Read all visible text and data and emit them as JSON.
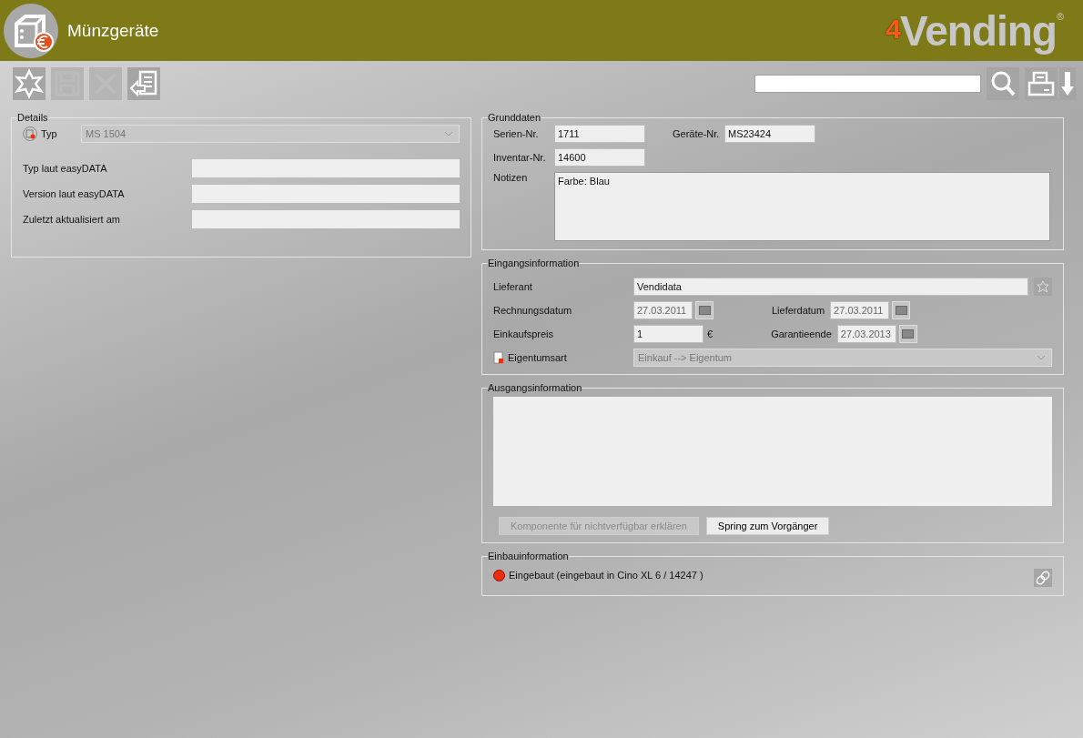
{
  "header": {
    "title": "Münzgeräte",
    "logo": {
      "prefix": "4",
      "text": "Vending",
      "mark": "®"
    }
  },
  "toolbar": [
    {
      "kind": "new",
      "disabled": false
    },
    {
      "kind": "save",
      "disabled": true
    },
    {
      "kind": "delete",
      "disabled": true
    },
    {
      "kind": "back",
      "disabled": false
    }
  ],
  "details": {
    "title": "Details",
    "type": {
      "label": "Typ",
      "value": "MS 1504",
      "disabled": true
    },
    "fields": [
      {
        "label": "Typ laut easyDATA"
      },
      {
        "label": "Version laut easyDATA"
      },
      {
        "label": "Zuletzt aktualisiert am"
      }
    ]
  },
  "grunddaten": {
    "title": "Grunddaten",
    "serial": {
      "label": "Serien-Nr.",
      "value": "1711"
    },
    "device": {
      "label": "Geräte-Nr.",
      "value": "MS23424"
    },
    "inventory": {
      "label": "Inventar-Nr.",
      "value": "14600"
    },
    "notes": {
      "label": "Notizen",
      "value": "Farbe: Blau"
    }
  },
  "eingang": {
    "title": "Eingangsinformation",
    "supplier": {
      "label": "Lieferant",
      "value": "Vendidata"
    },
    "invoice_date": {
      "label": "Rechnungsdatum",
      "value": "27.03.2011",
      "disabled": true
    },
    "delivery_date": {
      "label": "Lieferdatum",
      "value": "27.03.2011",
      "disabled": true
    },
    "price": {
      "label": "Einkaufspreis",
      "value": "1",
      "currency": "€"
    },
    "warranty_end": {
      "label": "Garantieende",
      "value": "27.03.2013",
      "disabled": true
    },
    "ownership": {
      "label": "Eigentumsart",
      "value": "Einkauf --> Eigentum",
      "disabled": true
    }
  },
  "ausgang": {
    "title": "Ausgangsinformation",
    "buttons": [
      {
        "label": "Komponente für nichtverfügbar erklären",
        "disabled": true
      },
      {
        "label": "Spring zum Vorgänger",
        "disabled": false
      }
    ]
  },
  "einbau": {
    "title": "Einbauinformation",
    "status": {
      "text": "Eingebaut (eingebaut in Cino XL 6 / 14247 )",
      "color": "#e8300c"
    }
  }
}
